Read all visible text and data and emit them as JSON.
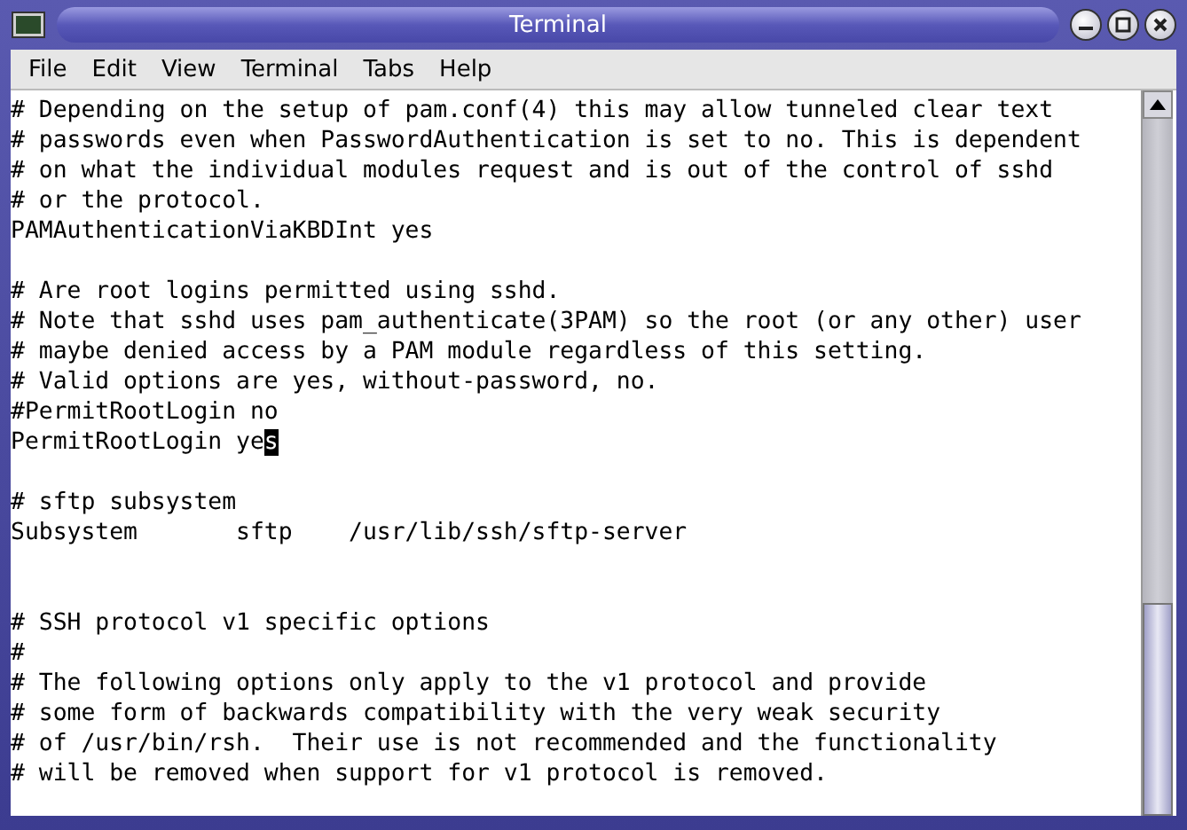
{
  "window": {
    "title": "Terminal"
  },
  "menu": [
    "File",
    "Edit",
    "View",
    "Terminal",
    "Tabs",
    "Help"
  ],
  "lines": [
    {
      "kind": "text",
      "text": "# Depending on the setup of pam.conf(4) this may allow tunneled clear text"
    },
    {
      "kind": "text",
      "text": "# passwords even when PasswordAuthentication is set to no. This is dependent"
    },
    {
      "kind": "text",
      "text": "# on what the individual modules request and is out of the control of sshd"
    },
    {
      "kind": "text",
      "text": "# or the protocol."
    },
    {
      "kind": "text",
      "text": "PAMAuthenticationViaKBDInt yes"
    },
    {
      "kind": "blank"
    },
    {
      "kind": "text",
      "text": "# Are root logins permitted using sshd."
    },
    {
      "kind": "text",
      "text": "# Note that sshd uses pam_authenticate(3PAM) so the root (or any other) user"
    },
    {
      "kind": "text",
      "text": "# maybe denied access by a PAM module regardless of this setting."
    },
    {
      "kind": "text",
      "text": "# Valid options are yes, without-password, no."
    },
    {
      "kind": "text",
      "text": "#PermitRootLogin no"
    },
    {
      "kind": "text",
      "text": "PermitRootLogin yes",
      "cursor": true
    },
    {
      "kind": "blank"
    },
    {
      "kind": "text",
      "text": "# sftp subsystem"
    },
    {
      "kind": "text",
      "text": "Subsystem       sftp    /usr/lib/ssh/sftp-server"
    },
    {
      "kind": "blank"
    },
    {
      "kind": "blank"
    },
    {
      "kind": "text",
      "text": "# SSH protocol v1 specific options"
    },
    {
      "kind": "text",
      "text": "#"
    },
    {
      "kind": "text",
      "text": "# The following options only apply to the v1 protocol and provide"
    },
    {
      "kind": "text",
      "text": "# some form of backwards compatibility with the very weak security"
    },
    {
      "kind": "text",
      "text": "# of /usr/bin/rsh.  Their use is not recommended and the functionality"
    },
    {
      "kind": "text",
      "text": "# will be removed when support for v1 protocol is removed."
    }
  ]
}
